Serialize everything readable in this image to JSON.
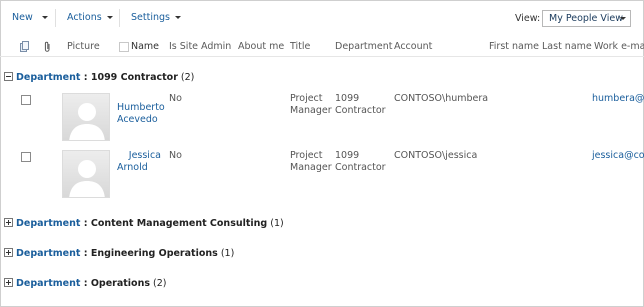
{
  "toolbar": {
    "new_label": "New",
    "actions_label": "Actions",
    "settings_label": "Settings",
    "view_label": "View:",
    "view_value": "My People View"
  },
  "columns": {
    "picture": "Picture",
    "name": "Name",
    "is_site_admin": "Is Site Admin",
    "about_me": "About me",
    "title": "Title",
    "department": "Department",
    "account": "Account",
    "first_name": "First name",
    "last_name": "Last name",
    "work_email": "Work e-ma"
  },
  "groups": [
    {
      "label": "Department",
      "sep": " : ",
      "value": "1099 Contractor",
      "count": "(2)",
      "expanded": true,
      "rows": [
        {
          "name_line1": "Humberto",
          "name_line2": "Acevedo",
          "is_site_admin": "No",
          "title_line1": "Project",
          "title_line2": "Manager",
          "dept_line1": "1099",
          "dept_line2": "Contractor",
          "account": "CONTOSO\\humbera",
          "email": "humbera@co"
        },
        {
          "name_line1": "Jessica",
          "name_line2": "Arnold",
          "is_site_admin": "No",
          "title_line1": "Project",
          "title_line2": "Manager",
          "dept_line1": "1099",
          "dept_line2": "Contractor",
          "account": "CONTOSO\\jessica",
          "email": "jessica@co"
        }
      ]
    },
    {
      "label": "Department",
      "sep": " : ",
      "value": "Content Management Consulting",
      "count": "(1)",
      "expanded": false
    },
    {
      "label": "Department",
      "sep": " : ",
      "value": "Engineering Operations",
      "count": "(1)",
      "expanded": false
    },
    {
      "label": "Department",
      "sep": " : ",
      "value": "Operations",
      "count": "(2)",
      "expanded": false
    }
  ],
  "icons": {
    "doc": "document-type-icon",
    "attach": "attachment-icon",
    "expand": "expand-icon",
    "collapse": "collapse-icon",
    "avatar": "person-placeholder-icon"
  },
  "colors": {
    "link": "#1a5e9c",
    "group_value": "#222222"
  }
}
